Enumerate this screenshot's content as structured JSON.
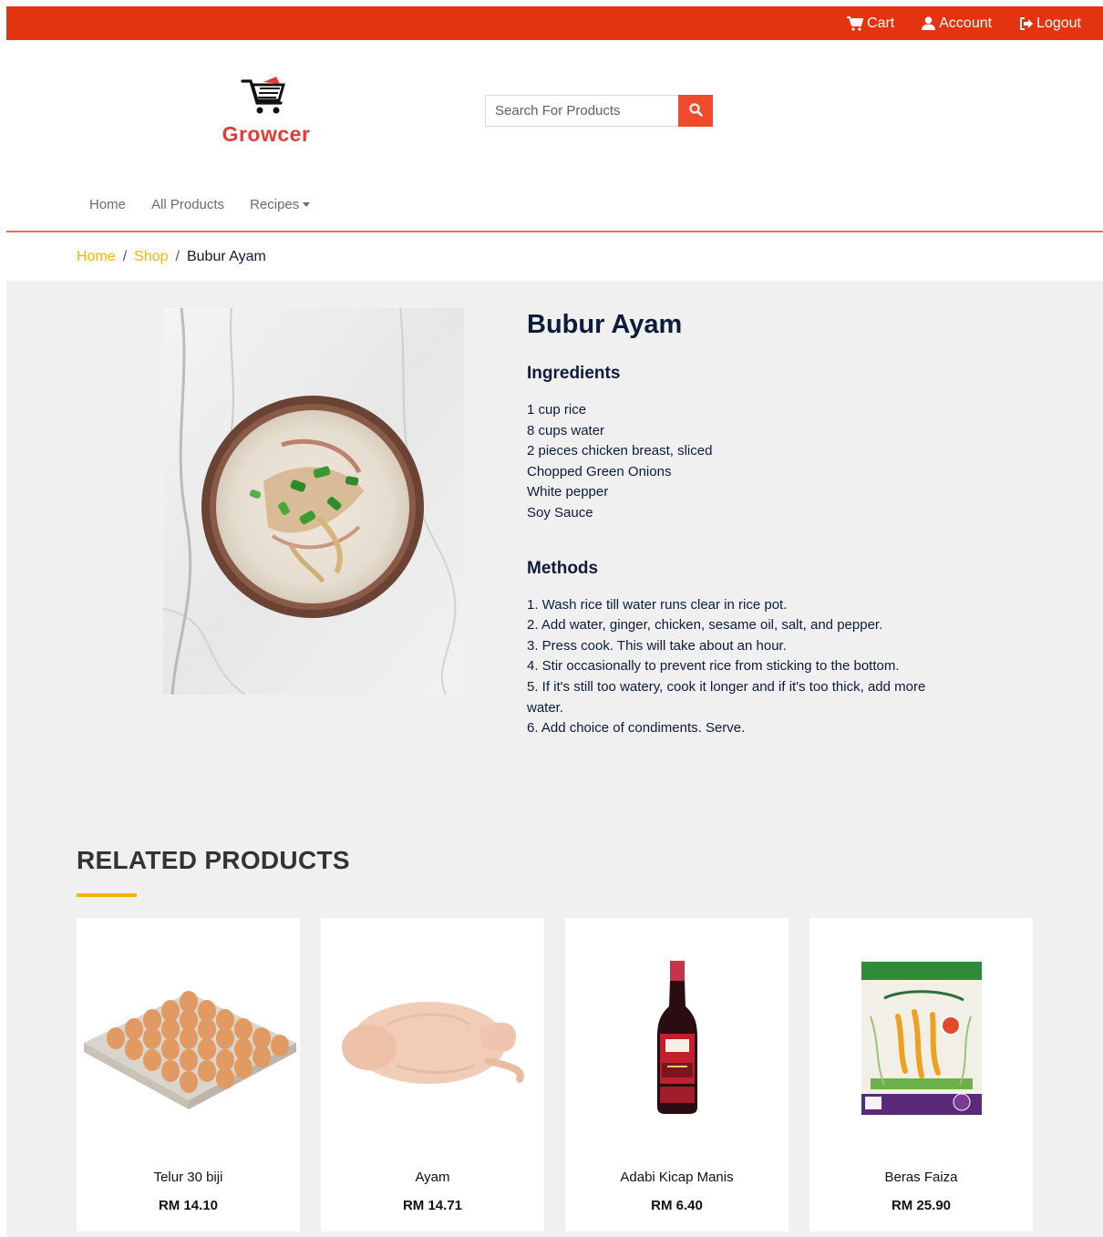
{
  "topbar": {
    "cart_label": "Cart",
    "account_label": "Account",
    "logout_label": "Logout",
    "background": "#e33310"
  },
  "logo": {
    "text": "Growcer",
    "color": "#e33a36"
  },
  "search": {
    "placeholder": "Search For Products",
    "button_color": "#f04b2b"
  },
  "nav": {
    "home": "Home",
    "all_products": "All Products",
    "recipes": "Recipes"
  },
  "breadcrumb": {
    "home": "Home",
    "sep1": "/",
    "shop": "Shop",
    "sep2": "/",
    "current": "Bubur Ayam",
    "link_color": "#f3b500"
  },
  "recipe": {
    "title": "Bubur Ayam",
    "ingredients_title": "Ingredients",
    "ingredients": [
      "1 cup rice",
      "8 cups water",
      "2 pieces chicken breast, sliced",
      "Chopped Green Onions",
      "White pepper",
      "Soy Sauce"
    ],
    "methods_title": "Methods",
    "methods": [
      "1. Wash rice till water runs clear in rice pot.",
      "2. Add water, ginger, chicken, sesame oil, salt, and pepper.",
      "3. Press cook. This will take about an hour.",
      "4. Stir occasionally to prevent rice from sticking to the bottom.",
      "5. If it's still too watery, cook it longer and if it's too thick, add more water.",
      "6. Add choice of condiments. Serve."
    ]
  },
  "related": {
    "title": "RELATED PRODUCTS",
    "products": [
      {
        "name": "Telur 30 biji",
        "price": "RM 14.10"
      },
      {
        "name": "Ayam",
        "price": "RM 14.71"
      },
      {
        "name": "Adabi Kicap Manis",
        "price": "RM 6.40"
      },
      {
        "name": "Beras Faiza",
        "price": "RM 25.90"
      }
    ]
  }
}
